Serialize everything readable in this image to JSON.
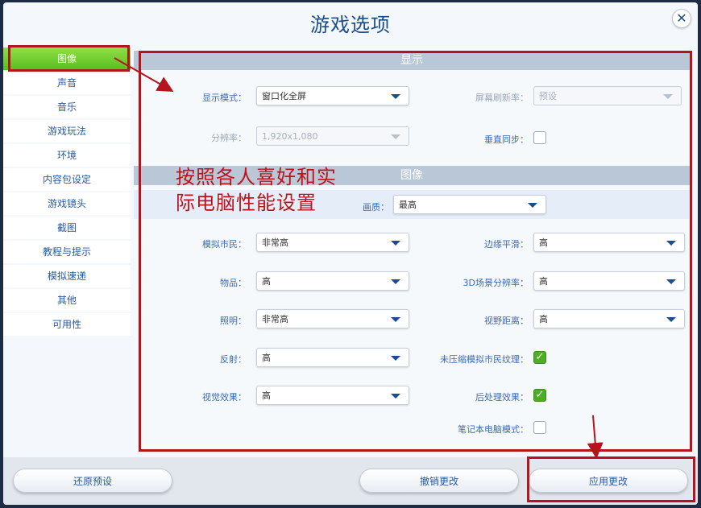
{
  "dialog": {
    "title": "游戏选项",
    "close_glyph": "✕"
  },
  "sidebar": {
    "items": [
      {
        "label": "图像",
        "active": true
      },
      {
        "label": "声音"
      },
      {
        "label": "音乐"
      },
      {
        "label": "游戏玩法"
      },
      {
        "label": "环境"
      },
      {
        "label": "内容包设定"
      },
      {
        "label": "游戏镜头"
      },
      {
        "label": "截图"
      },
      {
        "label": "教程与提示"
      },
      {
        "label": "模拟速递"
      },
      {
        "label": "其他"
      },
      {
        "label": "可用性"
      }
    ]
  },
  "display": {
    "header": "显示",
    "mode_label": "显示模式：",
    "mode_value": "窗口化全屏",
    "refresh_label": "屏幕刷新率：",
    "refresh_value": "预设",
    "resolution_label": "分辨率：",
    "resolution_value": "1,920x1,080",
    "vsync_label": "垂直同步："
  },
  "graphics": {
    "header": "图像",
    "quality_label": "画质：",
    "quality_value": "最高",
    "sims_label": "模拟市民：",
    "sims_value": "非常高",
    "aa_label": "边缘平滑：",
    "aa_value": "高",
    "objects_label": "物品：",
    "objects_value": "高",
    "res3d_label": "3D场景分辨率：",
    "res3d_value": "高",
    "lighting_label": "照明：",
    "lighting_value": "非常高",
    "view_label": "视野距离：",
    "view_value": "高",
    "reflect_label": "反射：",
    "reflect_value": "高",
    "uncompressed_label": "未压缩模拟市民纹理：",
    "visual_label": "视觉效果：",
    "visual_value": "高",
    "post_label": "后处理效果：",
    "laptop_label": "笔记本电脑模式：",
    "check_glyph": "✓"
  },
  "annotation": {
    "line1": "按照各人喜好和实",
    "line2": "际电脑性能设置"
  },
  "footer": {
    "restore": "还原预设",
    "cancel": "撤销更改",
    "apply": "应用更改"
  },
  "colors": {
    "accent_green": "#5bbd1e",
    "annotation_red": "#b4141c",
    "title_blue": "#1a4c8e"
  }
}
